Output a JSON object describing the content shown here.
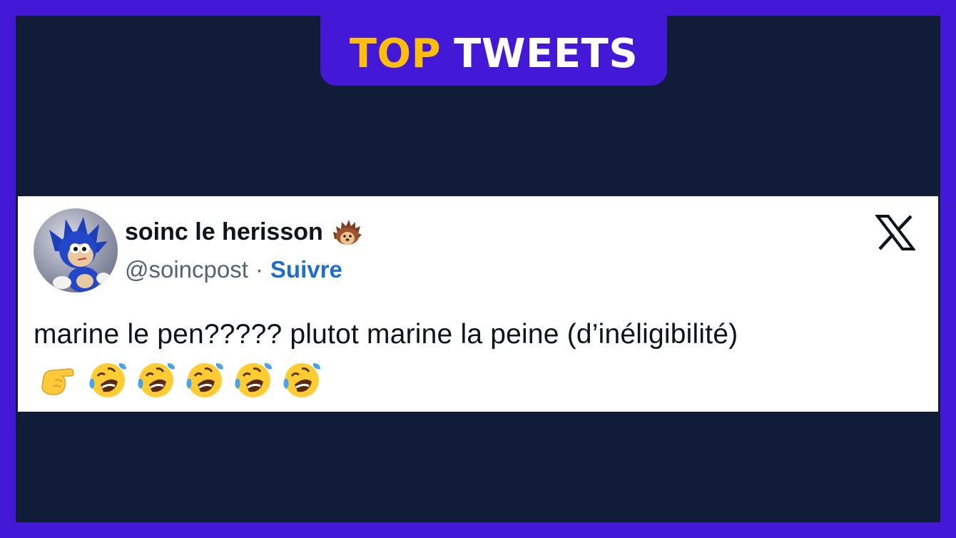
{
  "banner": {
    "word1": "TOP",
    "word2": "TWEETS",
    "word1_color": "#ffbe0b",
    "word2_color": "#ffffff"
  },
  "tweet": {
    "display_name": "soinc le herisson",
    "name_emoji_icon": "hedgehog-icon",
    "handle": "@soincpost",
    "separator": "·",
    "follow_label": "Suivre",
    "platform_icon": "x-logo-icon",
    "text": "marine le pen????? plutot marine la peine (d’inéligibilité)",
    "emojis": [
      "pointing-hand-icon",
      "rofl-icon",
      "rofl-icon",
      "rofl-icon",
      "rofl-icon",
      "rofl-icon"
    ]
  },
  "colors": {
    "outer_border": "#4318d6",
    "background": "#111c38",
    "card": "#ffffff",
    "link": "#1d6fc9"
  }
}
